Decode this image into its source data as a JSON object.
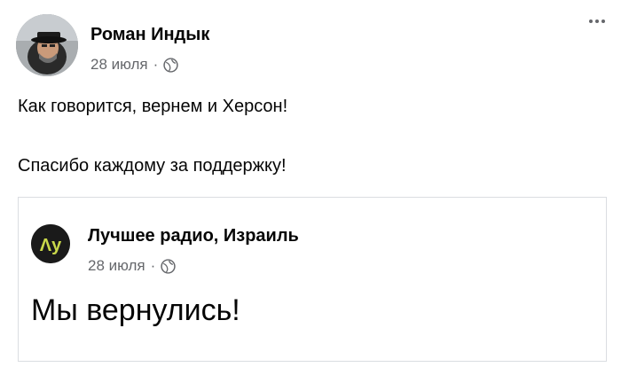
{
  "post": {
    "author": "Роман Индык",
    "date": "28 июля",
    "separator": "·",
    "line1": "Как говорится, вернем и Херсон!",
    "line2": "Спасибо каждому за поддержку!"
  },
  "shared_post": {
    "page_name": "Лучшее радио, Израиль",
    "date": "28 июля",
    "separator": "·",
    "text": "Мы вернулись!"
  },
  "colors": {
    "text_primary": "#050505",
    "text_secondary": "#65676b",
    "border": "#dadde1"
  },
  "icons": {
    "privacy": "globe-icon",
    "menu": "more-options-icon",
    "page_logo_text": "Λу"
  }
}
